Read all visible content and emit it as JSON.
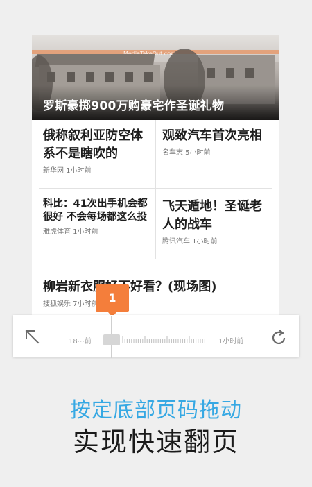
{
  "hero": {
    "watermark": "MediaTakeOut.com",
    "title": "罗斯豪掷900万购豪宅作圣诞礼物"
  },
  "articles": [
    {
      "title": "俄称叙利亚防空体系不是瞎吹的",
      "source": "新华网 1小时前"
    },
    {
      "title": "观致汽车首次亮相",
      "source": "名车志 5小时前"
    },
    {
      "title": "科比：41次出手机会都很好 不会每场都这么投",
      "source": "雅虎体育 1小时前"
    },
    {
      "title": "飞天遁地！圣诞老人的战车",
      "source": "腾讯汽车 1小时前"
    },
    {
      "title": "柳岩新衣服好不好看？(现场图)",
      "source": "搜狐娱乐 7小时前"
    }
  ],
  "pager": {
    "badge": "1",
    "left_label": "18⋯前",
    "right_label": "1小时前",
    "back_icon": "arrow-up-left-icon",
    "refresh_icon": "refresh-icon"
  },
  "caption": {
    "line1": "按定底部页码拖动",
    "line2": "实现快速翻页"
  },
  "colors": {
    "accent_blue": "#36a8e3",
    "badge_orange": "#f47e3b"
  }
}
